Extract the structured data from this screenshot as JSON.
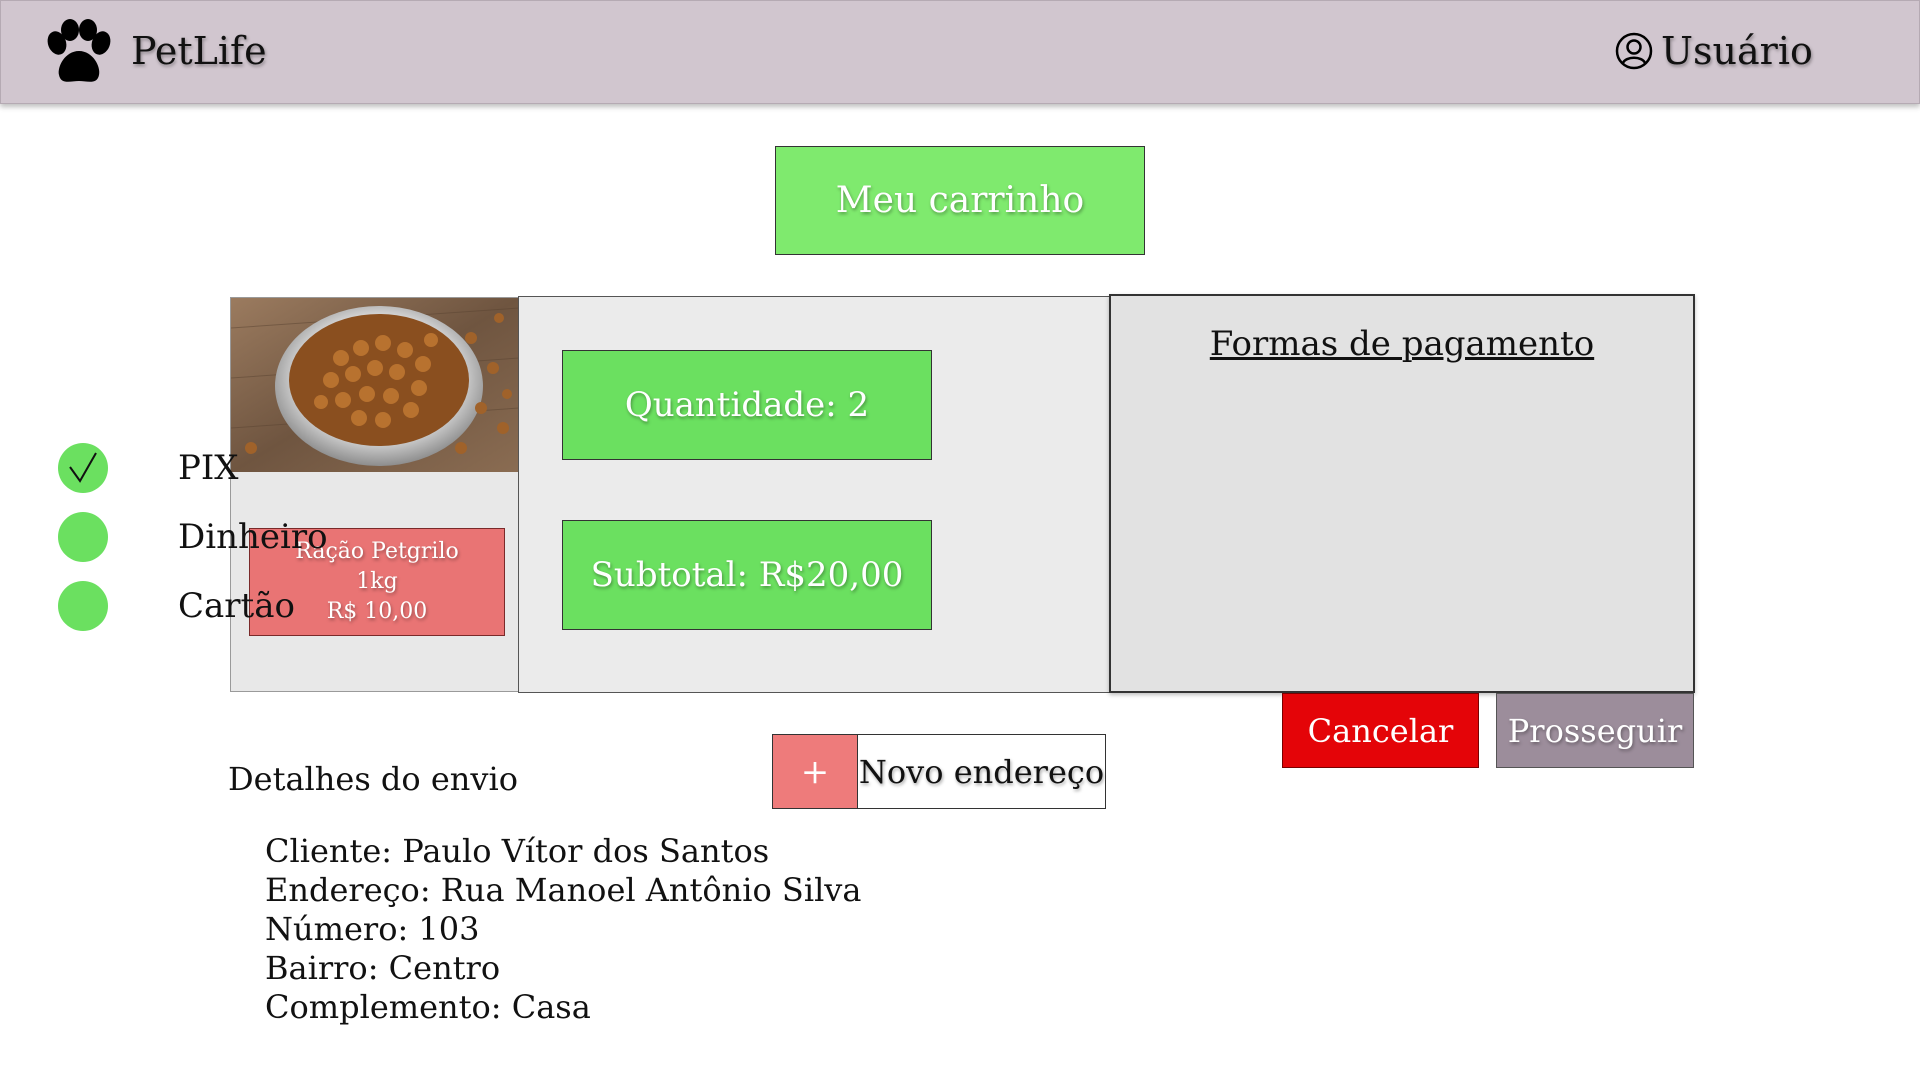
{
  "header": {
    "brand": "PetLife",
    "user_label": "Usuário"
  },
  "cart": {
    "title": "Meu carrinho"
  },
  "product": {
    "name": "Ração Petgrilo",
    "size": "1kg",
    "price": "R$ 10,00"
  },
  "summary": {
    "quantity": "Quantidade: 2",
    "subtotal": "Subtotal: R$20,00"
  },
  "payment": {
    "title": "Formas de pagamento",
    "options": [
      {
        "label": "PIX",
        "selected": true
      },
      {
        "label": "Dinheiro",
        "selected": false
      },
      {
        "label": "Cartão",
        "selected": false
      }
    ],
    "accent_color": "#6be060"
  },
  "actions": {
    "cancel": "Cancelar",
    "proceed": "Prosseguir"
  },
  "shipping": {
    "title": "Detalhes do envio",
    "new_address_plus": "+",
    "new_address_label": "Novo endereço",
    "lines": [
      "Cliente: Paulo Vítor dos Santos",
      "Endereço: Rua Manoel Antônio Silva",
      "Número: 103",
      "Bairro: Centro",
      "Complemento: Casa"
    ]
  },
  "icons": {
    "logo": "paw-icon",
    "user": "user-circle-icon",
    "selected": "check-icon"
  }
}
